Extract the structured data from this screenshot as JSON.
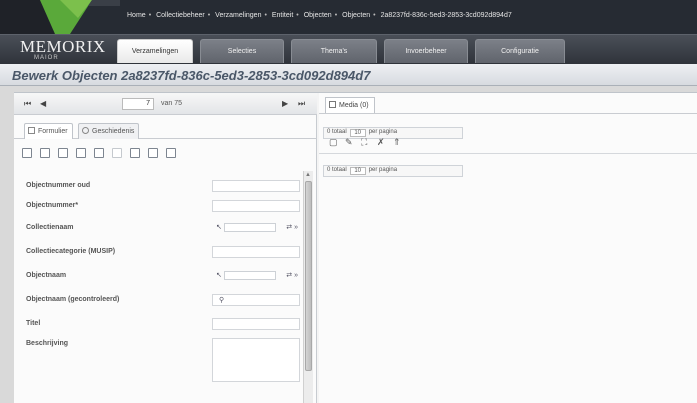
{
  "breadcrumb": [
    "Home",
    "Collectiebeheer",
    "Verzamelingen",
    "Entiteit",
    "Objecten",
    "Objecten",
    "2a8237fd-836c-5ed3-2853-3cd092d894d7"
  ],
  "logo": {
    "main": "MEMORIX",
    "sub": "MAIOR"
  },
  "nav_tabs": [
    "Verzamelingen",
    "Selecties",
    "Thema's",
    "Invoerbeheer",
    "Configuratie"
  ],
  "page_title": "Bewerk Objecten 2a8237fd-836c-5ed3-2853-3cd092d894d7",
  "pager": {
    "first": "⏮",
    "prev": "◀",
    "current": "7",
    "of": "van 75",
    "next": "▶",
    "last": "⏭"
  },
  "subtabs": [
    "Formulier",
    "Geschiedenis"
  ],
  "fields": [
    "Objectnummer oud",
    "Objectnummer*",
    "Collectienaam",
    "Collectiecategorie (MUSIP)",
    "Objectnaam",
    "Objectnaam (gecontroleerd)",
    "Titel",
    "Beschrijving"
  ],
  "media": {
    "tab": "Media (0)",
    "totaal_label": "0 totaal",
    "per_value": "10",
    "per_label": "per pagina"
  },
  "colors": {
    "accent_green": "#6cb33f",
    "header_dark": "#262b33",
    "title_text": "#4a5768"
  }
}
